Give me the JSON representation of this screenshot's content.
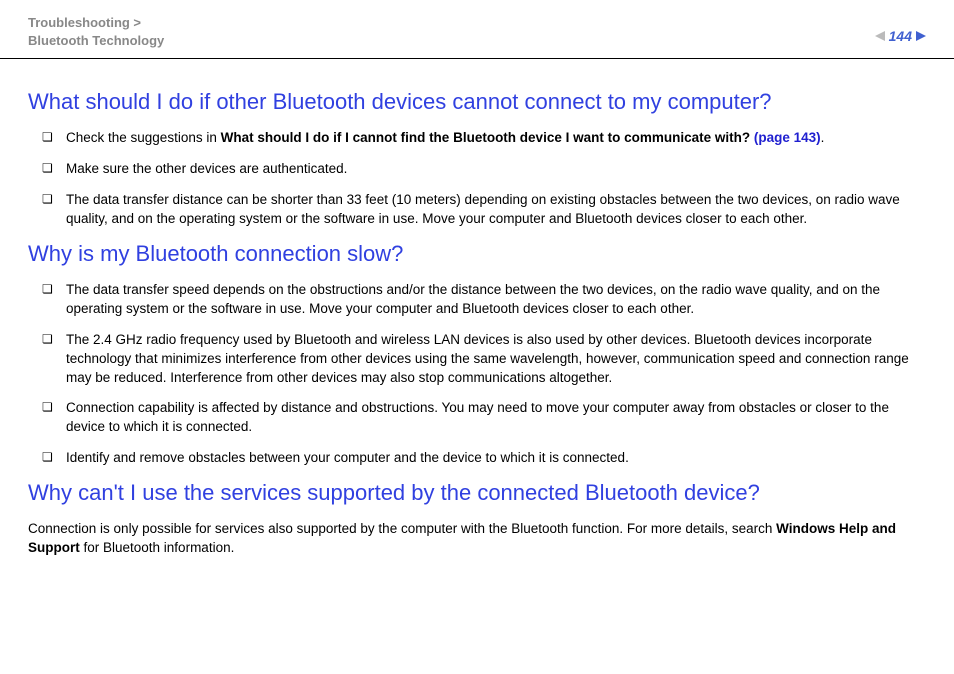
{
  "header": {
    "breadcrumb_line1": "Troubleshooting >",
    "breadcrumb_line2": "Bluetooth Technology",
    "page_number": "144"
  },
  "sections": {
    "s1": {
      "heading": "What should I do if other Bluetooth devices cannot connect to my computer?",
      "bullets": {
        "b1_prefix": "Check the suggestions in ",
        "b1_bold": "What should I do if I cannot find the Bluetooth device I want to communicate with? ",
        "b1_link": "(page 143)",
        "b1_suffix": ".",
        "b2": "Make sure the other devices are authenticated.",
        "b3": "The data transfer distance can be shorter than 33 feet (10 meters) depending on existing obstacles between the two devices, on radio wave quality, and on the operating system or the software in use. Move your computer and Bluetooth devices closer to each other."
      }
    },
    "s2": {
      "heading": "Why is my Bluetooth connection slow?",
      "bullets": {
        "b1": "The data transfer speed depends on the obstructions and/or the distance between the two devices, on the radio wave quality, and on the operating system or the software in use. Move your computer and Bluetooth devices closer to each other.",
        "b2": "The 2.4 GHz radio frequency used by Bluetooth and wireless LAN devices is also used by other devices. Bluetooth devices incorporate technology that minimizes interference from other devices using the same wavelength, however, communication speed and connection range may be reduced. Interference from other devices may also stop communications altogether.",
        "b3": "Connection capability is affected by distance and obstructions. You may need to move your computer away from obstacles or closer to the device to which it is connected.",
        "b4": "Identify and remove obstacles between your computer and the device to which it is connected."
      }
    },
    "s3": {
      "heading": "Why can't I use the services supported by the connected Bluetooth device?",
      "para_prefix": "Connection is only possible for services also supported by the computer with the Bluetooth function. For more details, search ",
      "para_bold": "Windows Help and Support",
      "para_suffix": " for Bluetooth information."
    }
  }
}
